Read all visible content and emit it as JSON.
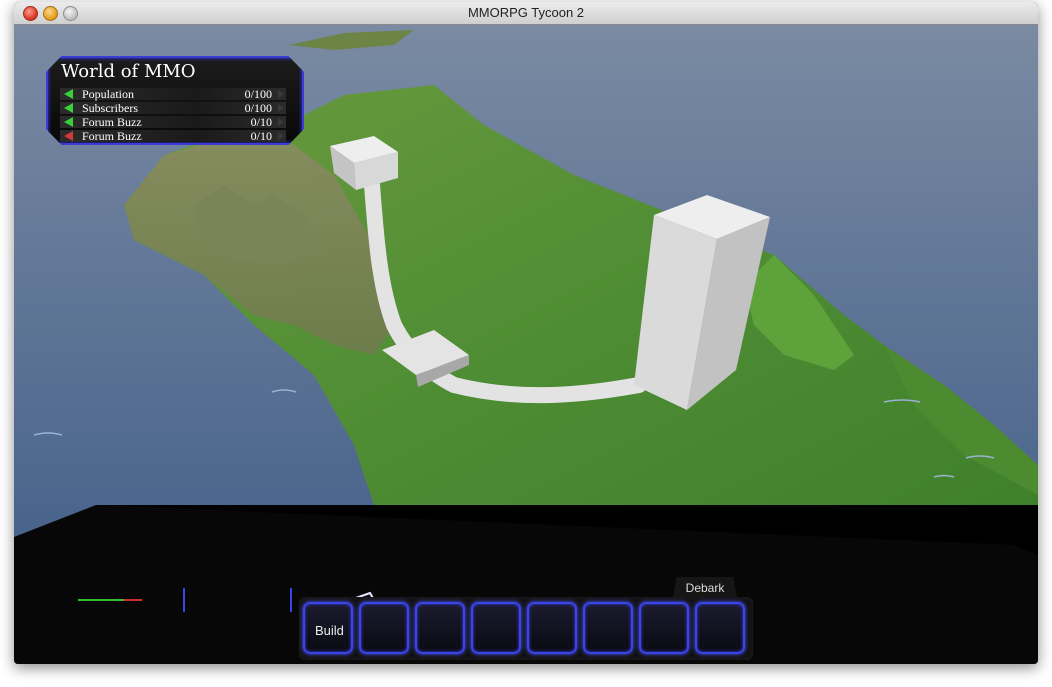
{
  "window": {
    "title": "MMORPG Tycoon 2"
  },
  "stats": {
    "title": "World of MMO",
    "rows": [
      {
        "label": "Population",
        "value": "0/100",
        "trend": "up",
        "color": "#39d13a"
      },
      {
        "label": "Subscribers",
        "value": "0/100",
        "trend": "up",
        "color": "#39d13a"
      },
      {
        "label": "Forum Buzz",
        "value": "0/10",
        "trend": "up",
        "color": "#39d13a"
      },
      {
        "label": "Forum Buzz",
        "value": "0/10",
        "trend": "down",
        "color": "#d23a3a"
      }
    ]
  },
  "toolbar": {
    "debark_label": "Debark",
    "slots": [
      {
        "label": "Build"
      },
      {
        "label": ""
      },
      {
        "label": ""
      },
      {
        "label": ""
      },
      {
        "label": ""
      },
      {
        "label": ""
      },
      {
        "label": ""
      },
      {
        "label": ""
      }
    ],
    "accent_color": "#3b44e6"
  },
  "colors": {
    "sea": "#3a5a86",
    "sky": "#6a7c98",
    "grass": "#58973a",
    "building": "#d6d6d6"
  }
}
